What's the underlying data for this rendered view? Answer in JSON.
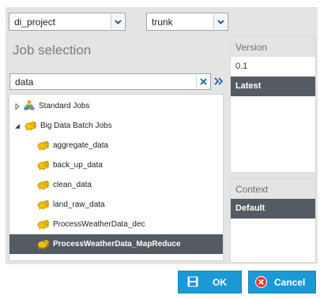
{
  "project_combo": {
    "value": "di_project"
  },
  "branch_combo": {
    "value": "trunk"
  },
  "job_panel": {
    "title": "Job selection",
    "search_value": "data"
  },
  "tree": {
    "nodes": [
      {
        "label": "Standard Jobs",
        "icon": "standard-jobs-icon",
        "expanded": false
      },
      {
        "label": "Big Data Batch Jobs",
        "icon": "big-data-folder-icon",
        "expanded": true
      },
      {
        "label": "aggregate_data",
        "icon": "hadoop-job-icon"
      },
      {
        "label": "back_up_data",
        "icon": "hadoop-job-icon"
      },
      {
        "label": "clean_data",
        "icon": "hadoop-job-icon"
      },
      {
        "label": "land_raw_data",
        "icon": "hadoop-job-icon"
      },
      {
        "label": "ProcessWeatherData_dec",
        "icon": "hadoop-job-icon"
      },
      {
        "label": "ProcessWeatherData_MapReduce",
        "icon": "hadoop-job-icon",
        "selected": true
      }
    ]
  },
  "version_panel": {
    "header": "Version",
    "items": [
      "0.1",
      "Latest"
    ],
    "selected": "Latest"
  },
  "context_panel": {
    "header": "Context",
    "items": [
      "Default"
    ],
    "selected": "Default"
  },
  "buttons": {
    "ok_label": "OK",
    "cancel_label": "Cancel"
  },
  "colors": {
    "accent": "#1b99d6",
    "selection": "#555b63",
    "panel": "#e4e4e4"
  }
}
